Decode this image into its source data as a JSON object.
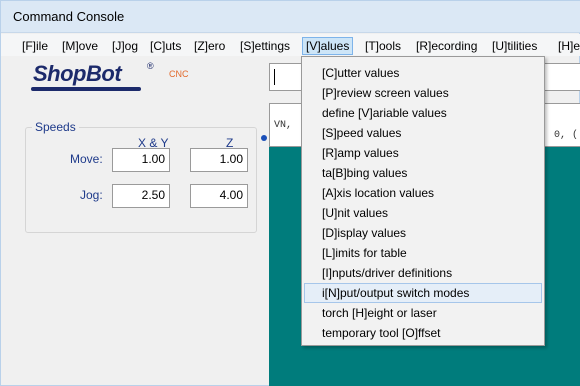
{
  "window": {
    "title": "Command Console"
  },
  "menubar": {
    "items": [
      "[F]ile",
      "[M]ove",
      "[J]og",
      "[C]uts",
      "[Z]ero",
      "[S]ettings",
      "[V]alues",
      "[T]ools",
      "[R]ecording",
      "[U]tilities",
      "[H]e"
    ],
    "active": "[V]alues"
  },
  "logo": {
    "text": "ShopBot",
    "reg": "®",
    "tag": "CNC"
  },
  "speeds": {
    "legend": "Speeds",
    "col_xy": "X & Y",
    "col_z": "Z",
    "move_label": "Move:",
    "jog_label": "Jog:",
    "move_xy": "1.00",
    "move_z": "1.00",
    "jog_xy": "2.50",
    "jog_z": "4.00"
  },
  "display": {
    "prefix": "VN,",
    "suffix": "0,  ("
  },
  "values_menu": {
    "items": [
      "[C]utter values",
      "[P]review screen values",
      "define [V]ariable values",
      "[S]peed values",
      "[R]amp values",
      "ta[B]bing values",
      "[A]xis location values",
      "[U]nit values",
      "[D]isplay values",
      "[L]imits for table",
      "[I]nputs/driver definitions",
      "i[N]put/output switch modes",
      "torch [H]eight or laser",
      "temporary tool [O]ffset"
    ],
    "highlighted": "i[N]put/output switch modes"
  },
  "colors": {
    "workspace": "#007c7c",
    "logo": "#1c2a6b",
    "label": "#1e3a8a"
  }
}
